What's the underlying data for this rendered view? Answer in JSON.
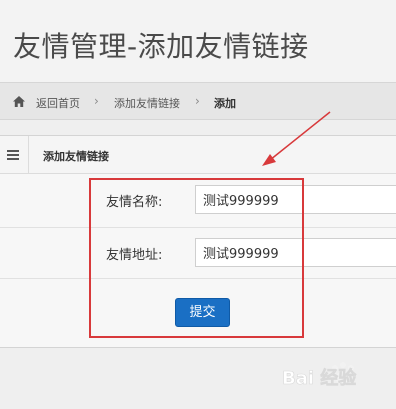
{
  "header": {
    "title": "友情管理-添加友情链接"
  },
  "breadcrumb": {
    "home": "返回首页",
    "section": "添加友情链接",
    "current": "添加",
    "separator": "›"
  },
  "panel": {
    "title": "添加友情链接"
  },
  "form": {
    "name_label": "友情名称:",
    "name_value": "测试999999",
    "url_label": "友情地址:",
    "url_value": "测试999999",
    "submit_label": "提交"
  },
  "watermark": {
    "text": "Bai 经验"
  },
  "colors": {
    "accent": "#1a6fc4",
    "annotation": "#d8393b"
  },
  "icons": {
    "home": "home-icon",
    "menu": "menu-icon"
  }
}
